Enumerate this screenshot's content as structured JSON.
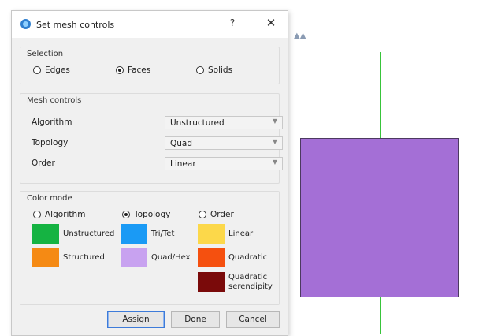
{
  "dialog": {
    "title": "Set mesh controls",
    "help_label": "?",
    "close_label": "✕"
  },
  "selection": {
    "title": "Selection",
    "options": [
      "Edges",
      "Faces",
      "Solids"
    ],
    "selected": "Faces"
  },
  "mesh_controls": {
    "title": "Mesh controls",
    "rows": [
      {
        "label": "Algorithm",
        "value": "Unstructured"
      },
      {
        "label": "Topology",
        "value": "Quad"
      },
      {
        "label": "Order",
        "value": "Linear"
      }
    ]
  },
  "color_mode": {
    "title": "Color mode",
    "options": [
      "Algorithm",
      "Topology",
      "Order"
    ],
    "selected": "Topology",
    "legend": {
      "algorithm": [
        {
          "label": "Unstructured",
          "color": "#15b342"
        },
        {
          "label": "Structured",
          "color": "#f58a14"
        }
      ],
      "topology": [
        {
          "label": "Tri/Tet",
          "color": "#1a9af5"
        },
        {
          "label": "Quad/Hex",
          "color": "#c8a2f0"
        }
      ],
      "order": [
        {
          "label": "Linear",
          "color": "#fcd84a"
        },
        {
          "label": "Quadratic",
          "color": "#f5500f"
        },
        {
          "label": "Quadratic serendipity",
          "color": "#7a0a0a"
        }
      ]
    }
  },
  "buttons": {
    "assign": "Assign",
    "done": "Done",
    "cancel": "Cancel"
  },
  "viewport": {
    "face_color": "#a46fd6",
    "axis_color": "#38c43a"
  }
}
